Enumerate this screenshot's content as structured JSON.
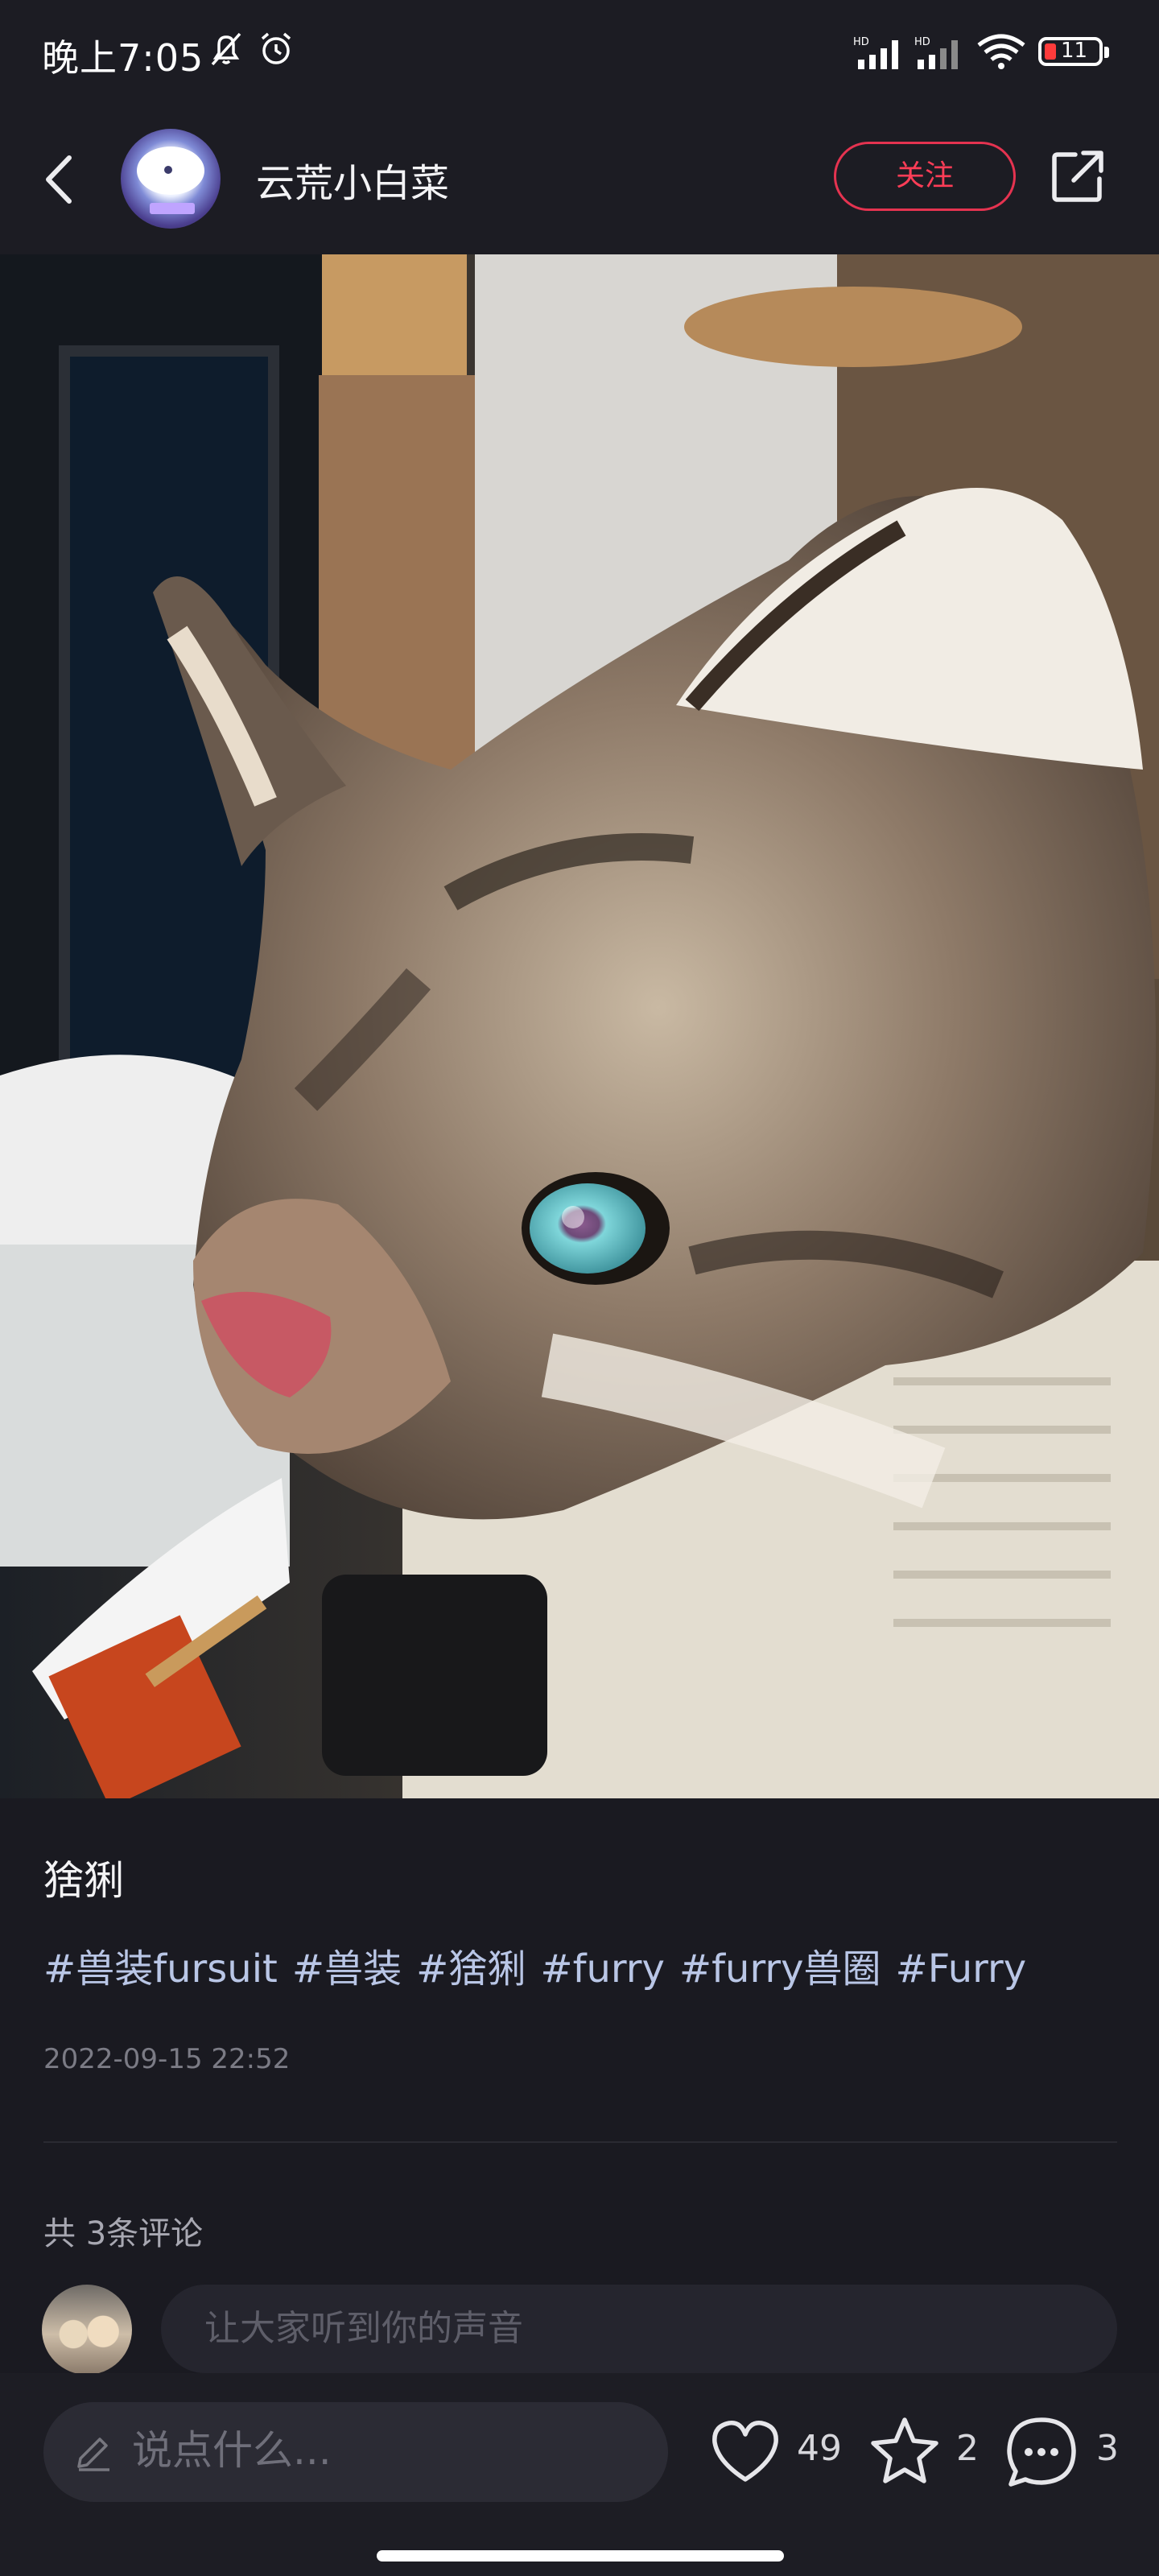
{
  "status_bar": {
    "time": "晚上7:05",
    "icons": [
      "mute-icon",
      "alarm-icon",
      "signal-icon",
      "signal-icon",
      "wifi-icon"
    ],
    "network_badge": "HD",
    "battery": "11",
    "battery_color": "#ff3b3b"
  },
  "header": {
    "back_icon": "chevron-left-icon",
    "username": "云荒小白菜",
    "follow_label": "关注",
    "share_icon": "share-icon",
    "follow_color": "#e53350"
  },
  "post": {
    "image_subject": "lynx fursuit head",
    "title": "猞猁",
    "tags": [
      "#兽装fursuit",
      "#兽装",
      "#猞猁",
      "#furry",
      "#furry兽圈",
      "#Furry"
    ],
    "date": "2022-09-15 22:52"
  },
  "comments": {
    "count_label": "共 3条评论",
    "input_placeholder": "让大家听到你的声音"
  },
  "bottom_bar": {
    "say_placeholder": "说点什么...",
    "likes": "49",
    "favorites": "2",
    "comments": "3"
  }
}
